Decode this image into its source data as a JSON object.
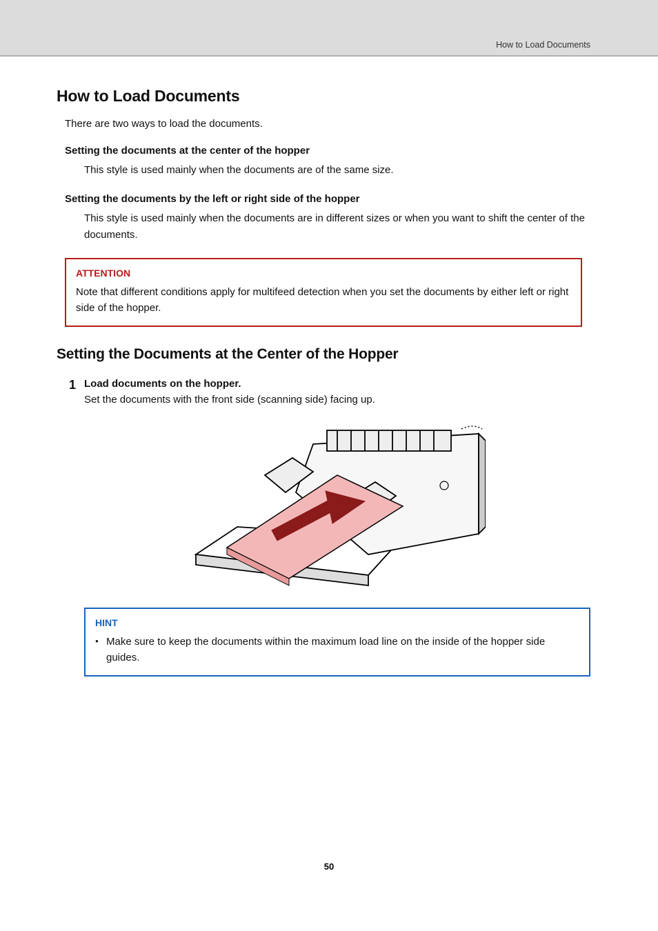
{
  "breadcrumb": "How to Load Documents",
  "title": "How to Load Documents",
  "intro": "There are two ways to load the documents.",
  "method1": {
    "heading": "Setting the documents at the center of the hopper",
    "body": "This style is used mainly when the documents are of the same size."
  },
  "method2": {
    "heading": "Setting the documents by the left or right side of the hopper",
    "body": "This style is used mainly when the documents are in different sizes or when you want to shift the center of the documents."
  },
  "attention": {
    "label": "ATTENTION",
    "text": "Note that different conditions apply for multifeed detection when you set the documents by either left or right side of the hopper."
  },
  "section_title": "Setting the Documents at the Center of the Hopper",
  "step1": {
    "num": "1",
    "heading": "Load documents on the hopper.",
    "text": "Set the documents with the front side (scanning side) facing up."
  },
  "hint": {
    "label": "HINT",
    "bullet": "Make sure to keep the documents within the maximum load line on the inside of the hopper side guides."
  },
  "page_number": "50"
}
